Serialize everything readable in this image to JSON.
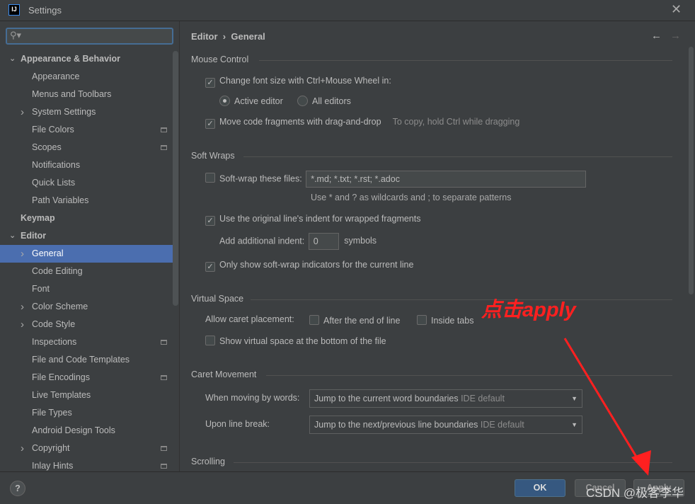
{
  "window": {
    "title": "Settings",
    "logo": "IJ",
    "close_icon": "close-icon"
  },
  "sidebar": {
    "search_placeholder": "",
    "items": [
      {
        "label": "Appearance & Behavior",
        "level": 0,
        "bold": true,
        "arrow": "down"
      },
      {
        "label": "Appearance",
        "level": 1
      },
      {
        "label": "Menus and Toolbars",
        "level": 1
      },
      {
        "label": "System Settings",
        "level": 1,
        "arrow": "right"
      },
      {
        "label": "File Colors",
        "level": 1,
        "project": true
      },
      {
        "label": "Scopes",
        "level": 1,
        "project": true
      },
      {
        "label": "Notifications",
        "level": 1
      },
      {
        "label": "Quick Lists",
        "level": 1
      },
      {
        "label": "Path Variables",
        "level": 1
      },
      {
        "label": "Keymap",
        "level": 0,
        "bold": true
      },
      {
        "label": "Editor",
        "level": 0,
        "bold": true,
        "arrow": "down"
      },
      {
        "label": "General",
        "level": 1,
        "arrow": "right",
        "selected": true
      },
      {
        "label": "Code Editing",
        "level": 1
      },
      {
        "label": "Font",
        "level": 1
      },
      {
        "label": "Color Scheme",
        "level": 1,
        "arrow": "right"
      },
      {
        "label": "Code Style",
        "level": 1,
        "arrow": "right"
      },
      {
        "label": "Inspections",
        "level": 1,
        "project": true
      },
      {
        "label": "File and Code Templates",
        "level": 1
      },
      {
        "label": "File Encodings",
        "level": 1,
        "project": true
      },
      {
        "label": "Live Templates",
        "level": 1
      },
      {
        "label": "File Types",
        "level": 1
      },
      {
        "label": "Android Design Tools",
        "level": 1
      },
      {
        "label": "Copyright",
        "level": 1,
        "arrow": "right",
        "project": true
      },
      {
        "label": "Inlay Hints",
        "level": 1,
        "project": true
      }
    ]
  },
  "breadcrumb": {
    "parent": "Editor",
    "sep": "›",
    "current": "General"
  },
  "main": {
    "mouse": {
      "title": "Mouse Control",
      "font_size": "Change font size with Ctrl+Mouse Wheel in:",
      "font_size_checked": true,
      "active_editor": "Active editor",
      "all_editors": "All editors",
      "selected": "Active editor",
      "drag": "Move code fragments with drag-and-drop",
      "drag_checked": true,
      "drag_hint": "To copy, hold Ctrl while dragging"
    },
    "softwraps": {
      "title": "Soft Wraps",
      "files_label": "Soft-wrap these files:",
      "files_checked": false,
      "files_value": "*.md; *.txt; *.rst; *.adoc",
      "files_hint": "Use * and ? as wildcards and ; to separate patterns",
      "indent": "Use the original line's indent for wrapped fragments",
      "indent_checked": true,
      "add_indent": "Add additional indent:",
      "add_indent_value": "0",
      "symbols": "symbols",
      "indicators": "Only show soft-wrap indicators for the current line",
      "indicators_checked": true
    },
    "virtual": {
      "title": "Virtual Space",
      "caret": "Allow caret placement:",
      "after_end": "After the end of line",
      "inside_tabs": "Inside tabs",
      "show_virtual": "Show virtual space at the bottom of the file"
    },
    "caret": {
      "title": "Caret Movement",
      "words_label": "When moving by words:",
      "words_value": "Jump to the current word boundaries",
      "words_hint": "IDE default",
      "break_label": "Upon line break:",
      "break_value": "Jump to the next/previous line boundaries",
      "break_hint": "IDE default"
    },
    "scrolling": {
      "title": "Scrolling"
    }
  },
  "footer": {
    "help": "?",
    "ok": "OK",
    "cancel": "Cancel",
    "apply": "Apply"
  },
  "annotation": {
    "text": "点击apply",
    "color": "#ff2020"
  },
  "watermark": "CSDN @极客李华",
  "colors": {
    "selection": "#4b6eaf",
    "ok_button": "#365880",
    "background": "#3c3f41"
  }
}
